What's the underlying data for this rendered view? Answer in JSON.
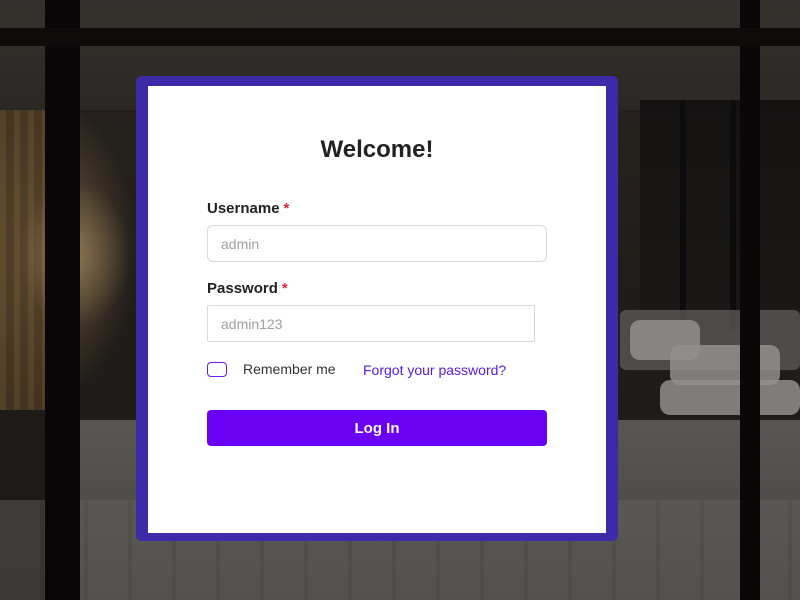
{
  "login": {
    "title": "Welcome!",
    "username_label": "Username",
    "password_label": "Password",
    "required_mark": "*",
    "username_placeholder": "admin",
    "password_placeholder": "admin123",
    "remember_label": "Remember me",
    "forgot_link": "Forgot your password?",
    "login_button": "Log In"
  },
  "colors": {
    "frame": "#3d2aa8",
    "button": "#6a00f4",
    "link": "#5a1be8",
    "required": "#e0243a"
  }
}
